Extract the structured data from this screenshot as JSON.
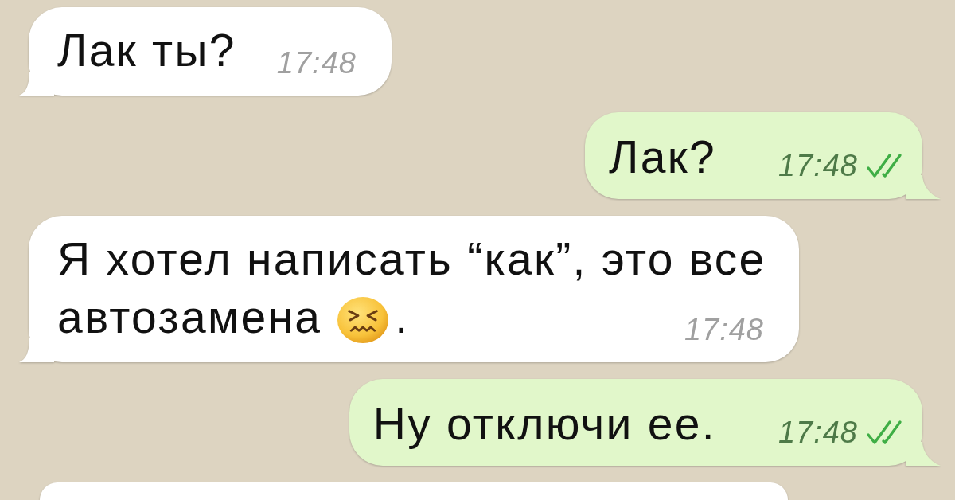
{
  "messages": [
    {
      "kind": "incoming",
      "parts": [
        {
          "kind": "text",
          "text": "Лак ты?"
        }
      ],
      "time": "17:48"
    },
    {
      "kind": "outgoing",
      "parts": [
        {
          "kind": "text",
          "text": "Лак?"
        }
      ],
      "time": "17:48",
      "delivered": true
    },
    {
      "kind": "incoming",
      "parts": [
        {
          "kind": "text",
          "text": "Я хотел написать “как”, это все"
        },
        {
          "kind": "text",
          "text": "автозамена"
        },
        {
          "kind": "emoji"
        },
        {
          "kind": "text",
          "text": "."
        }
      ],
      "time": "17:48"
    },
    {
      "kind": "outgoing",
      "parts": [
        {
          "kind": "text",
          "text": "Ну отключи ее."
        }
      ],
      "time": "17:48",
      "delivered": true
    },
    {
      "kind": "incoming"
    }
  ]
}
